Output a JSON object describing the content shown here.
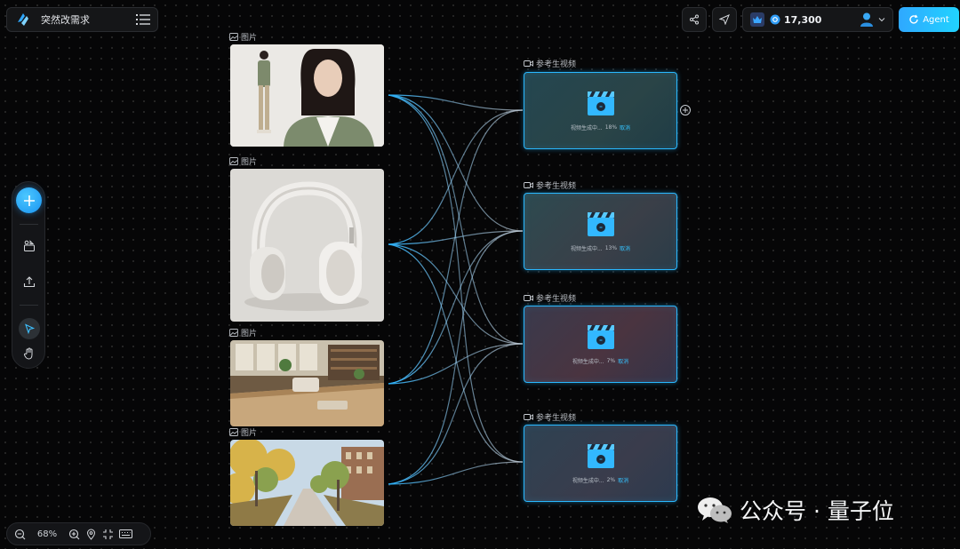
{
  "project": {
    "title": "突然改需求"
  },
  "toolbar": {
    "credits": "17,300",
    "agent_label": "Agent"
  },
  "zoom": {
    "level": "68%"
  },
  "image_nodes": [
    {
      "label": "图片"
    },
    {
      "label": "图片"
    },
    {
      "label": "图片"
    },
    {
      "label": "图片"
    }
  ],
  "video_nodes": [
    {
      "label": "参考生视频",
      "status": "视频生成中...",
      "progress": "18%",
      "cancel": "取消"
    },
    {
      "label": "参考生视频",
      "status": "视频生成中...",
      "progress": "13%",
      "cancel": "取消"
    },
    {
      "label": "参考生视频",
      "status": "视频生成中...",
      "progress": "7%",
      "cancel": "取消"
    },
    {
      "label": "参考生视频",
      "status": "视频生成中...",
      "progress": "2%",
      "cancel": "取消"
    }
  ],
  "watermark": {
    "text": "公众号 · 量子位"
  },
  "icons": {
    "logo": "app-logo-icon",
    "menu": "list-menu-icon",
    "share": "share-icon",
    "send": "send-icon",
    "crown": "crown-icon",
    "coin": "coin-icon",
    "avatar": "avatar-icon",
    "chevron": "chevron-down-icon",
    "agent": "agent-refresh-icon"
  },
  "colors": {
    "accent": "#29b8ff",
    "agent": "#2fa8ff"
  }
}
